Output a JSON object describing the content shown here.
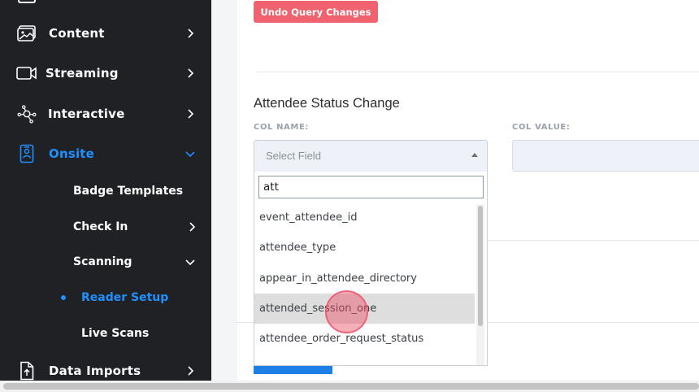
{
  "colors": {
    "sidebar_bg": "#1f2124",
    "accent": "#1e90ff",
    "undo_button": "#f0626e",
    "primary_button": "#1e7fe6"
  },
  "sidebar": {
    "items": [
      {
        "label": "Content",
        "icon": "image-icon",
        "chevron": "right"
      },
      {
        "label": "Streaming",
        "icon": "video-camera-icon",
        "chevron": "right"
      },
      {
        "label": "Interactive",
        "icon": "network-icon",
        "chevron": "right"
      },
      {
        "label": "Onsite",
        "icon": "badge-icon",
        "chevron": "down",
        "active": true
      },
      {
        "label": "Data Imports",
        "icon": "file-upload-icon",
        "chevron": "right"
      }
    ],
    "onsite_children": [
      {
        "label": "Badge Templates"
      },
      {
        "label": "Check In",
        "chevron": "right"
      },
      {
        "label": "Scanning",
        "chevron": "down"
      }
    ],
    "scanning_children": [
      {
        "label": "Reader Setup",
        "active": true
      },
      {
        "label": "Live Scans"
      }
    ]
  },
  "main": {
    "undo_button": "Undo Query Changes",
    "section_title": "Attendee Status Change",
    "col_name_label": "COL NAME:",
    "col_value_label": "COL VALUE:",
    "select_placeholder": "Select Field",
    "search_value": "att",
    "options": [
      "event_attendee_id",
      "attendee_type",
      "appear_in_attendee_directory",
      "attended_session_one",
      "attendee_order_request_status"
    ],
    "highlighted_option": "attended_session_one"
  }
}
